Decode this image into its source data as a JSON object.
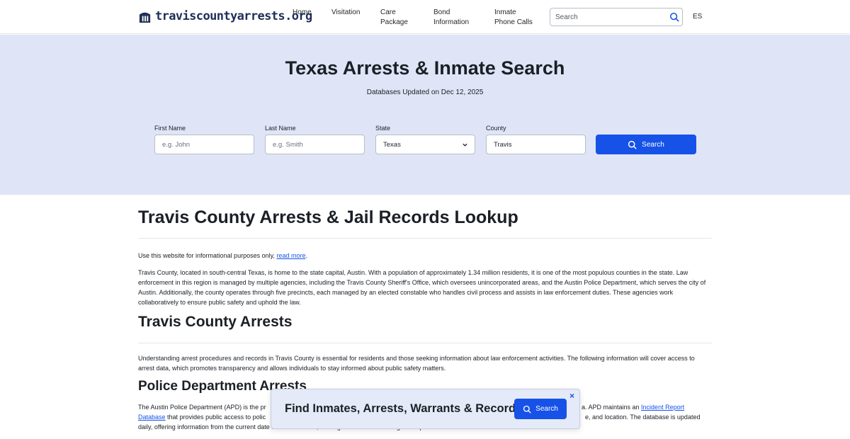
{
  "header": {
    "logo_text": "traviscountyarrests.org",
    "nav": [
      {
        "label": "Home"
      },
      {
        "label": "Visitation"
      },
      {
        "label": "Care Package"
      },
      {
        "label": "Bond Information"
      },
      {
        "label": "Inmate Phone Calls"
      }
    ],
    "search_placeholder": "Search",
    "lang_label": "ES"
  },
  "hero": {
    "title": "Texas Arrests & Inmate Search",
    "updated": "Databases Updated on Dec 12, 2025",
    "fields": {
      "first_name": {
        "label": "First Name",
        "placeholder": "e.g. John"
      },
      "last_name": {
        "label": "Last Name",
        "placeholder": "e.g. Smith"
      },
      "state": {
        "label": "State",
        "value": "Texas"
      },
      "county": {
        "label": "County",
        "value": "Travis"
      }
    },
    "search_button": "Search"
  },
  "content": {
    "heading1": "Travis County Arrests & Jail Records Lookup",
    "notice_pre": "Use this website for informational purposes only, ",
    "notice_link": "read more",
    "notice_post": ".",
    "intro": "Travis County, located in south-central Texas, is home to the state capital, Austin. With a population of approximately 1.34 million residents, it is one of the most populous counties in the state. Law enforcement in this region is managed by multiple agencies, including the Travis County Sheriff's Office, which oversees unincorporated areas, and the Austin Police Department, which serves the city of Austin. Additionally, the county operates through five precincts, each managed by an elected constable who handles civil process and assists in law enforcement duties. These agencies work collaboratively to ensure public safety and uphold the law.",
    "heading2": "Travis County Arrests",
    "arrests_para": "Understanding arrest procedures and records in Travis County is essential for residents and those seeking information about law enforcement activities. The following information will cover access to arrest data, which promotes transparency and allows individuals to stay informed about public safety matters.",
    "heading3": "Police Department Arrests",
    "apd_line1_start": "The Austin Police Department (APD) is the pr",
    "apd_line1_end": "a. APD maintains an ",
    "apd_link": "Incident Report",
    "apd_line2_link": "Database",
    "apd_line2_start": " that provides public access to polic",
    "apd_line2_end": "e, and location. The database is updated",
    "apd_line3": "daily, offering information from the current date back 18 months, making it accessible to the general public."
  },
  "popup": {
    "title": "Find Inmates, Arrests, Warrants & Records",
    "button": "Search",
    "close": "×"
  },
  "colors": {
    "accent": "#1652e8",
    "hero_bg": "#dfe5f6",
    "logo": "#1f2f57"
  },
  "icons": [
    "logo-icon",
    "search-icon",
    "chevron-down-icon",
    "close-icon"
  ]
}
